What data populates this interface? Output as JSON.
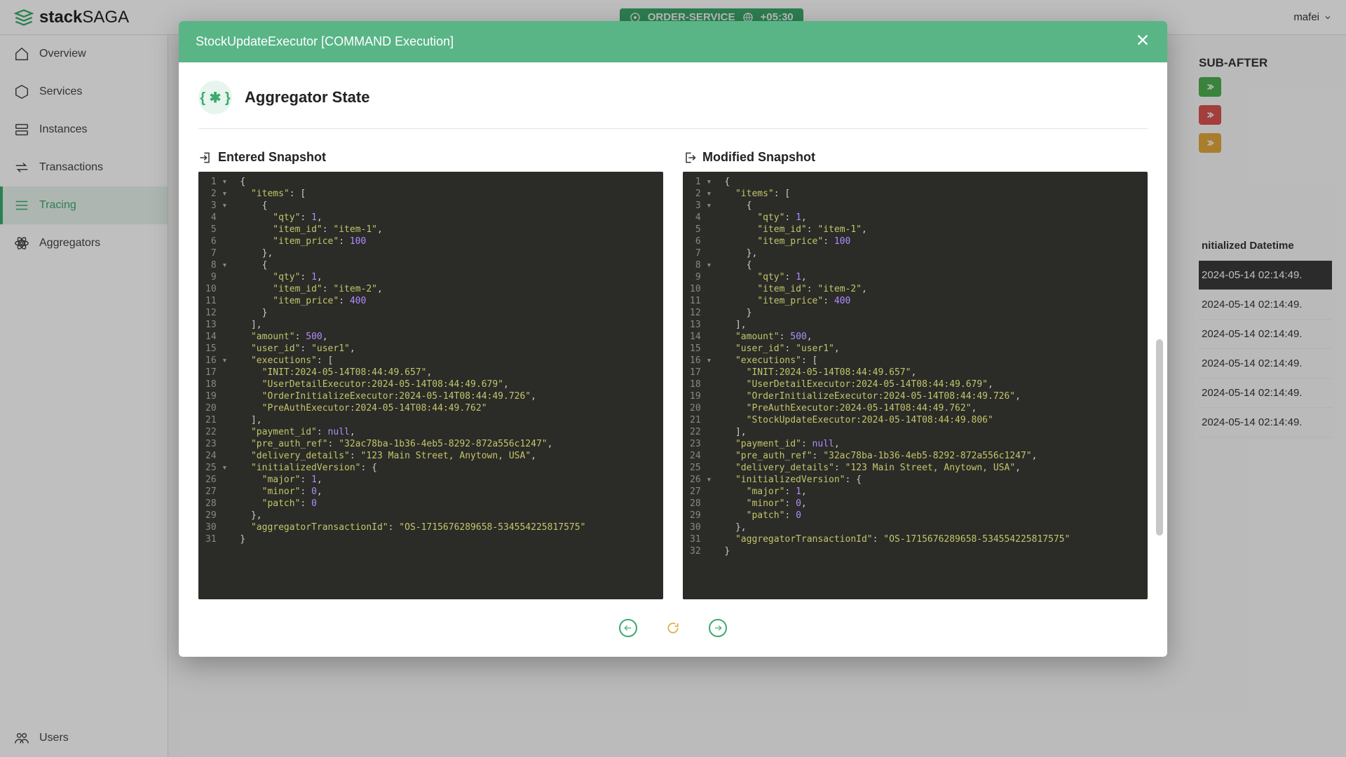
{
  "brand": {
    "part1": "stack",
    "part2": "SAGA"
  },
  "topbar": {
    "service": "ORDER-SERVICE",
    "tz": "+05:30",
    "user": "mafei"
  },
  "sidebar": {
    "items": [
      {
        "label": "Overview"
      },
      {
        "label": "Services"
      },
      {
        "label": "Instances"
      },
      {
        "label": "Transactions"
      },
      {
        "label": "Tracing"
      },
      {
        "label": "Aggregators"
      }
    ],
    "footer": {
      "label": "Users"
    }
  },
  "background": {
    "colHeader": "SUB-AFTER",
    "dtHeader": "nitialized Datetime",
    "rows": [
      "2024-05-14 02:14:49.",
      "2024-05-14 02:14:49.",
      "2024-05-14 02:14:49.",
      "2024-05-14 02:14:49.",
      "2024-05-14 02:14:49.",
      "2024-05-14 02:14:49."
    ]
  },
  "modal": {
    "title": "StockUpdateExecutor [COMMAND Execution]",
    "section": "Aggregator State",
    "entered": {
      "title": "Entered Snapshot"
    },
    "modified": {
      "title": "Modified Snapshot"
    },
    "enteredJson": {
      "items": [
        {
          "qty": 1,
          "item_id": "item-1",
          "item_price": 100
        },
        {
          "qty": 1,
          "item_id": "item-2",
          "item_price": 400
        }
      ],
      "amount": 500,
      "user_id": "user1",
      "executions": [
        "INIT:2024-05-14T08:44:49.657",
        "UserDetailExecutor:2024-05-14T08:44:49.679",
        "OrderInitializeExecutor:2024-05-14T08:44:49.726",
        "PreAuthExecutor:2024-05-14T08:44:49.762"
      ],
      "payment_id": null,
      "pre_auth_ref": "32ac78ba-1b36-4eb5-8292-872a556c1247",
      "delivery_details": "123 Main Street, Anytown, USA",
      "initializedVersion": {
        "major": 1,
        "minor": 0,
        "patch": 0
      },
      "aggregatorTransactionId": "OS-1715676289658-534554225817575"
    },
    "modifiedJson": {
      "items": [
        {
          "qty": 1,
          "item_id": "item-1",
          "item_price": 100
        },
        {
          "qty": 1,
          "item_id": "item-2",
          "item_price": 400
        }
      ],
      "amount": 500,
      "user_id": "user1",
      "executions": [
        "INIT:2024-05-14T08:44:49.657",
        "UserDetailExecutor:2024-05-14T08:44:49.679",
        "OrderInitializeExecutor:2024-05-14T08:44:49.726",
        "PreAuthExecutor:2024-05-14T08:44:49.762",
        "StockUpdateExecutor:2024-05-14T08:44:49.806"
      ],
      "payment_id": null,
      "pre_auth_ref": "32ac78ba-1b36-4eb5-8292-872a556c1247",
      "delivery_details": "123 Main Street, Anytown, USA",
      "initializedVersion": {
        "major": 1,
        "minor": 0,
        "patch": 0
      },
      "aggregatorTransactionId": "OS-1715676289658-534554225817575"
    }
  }
}
